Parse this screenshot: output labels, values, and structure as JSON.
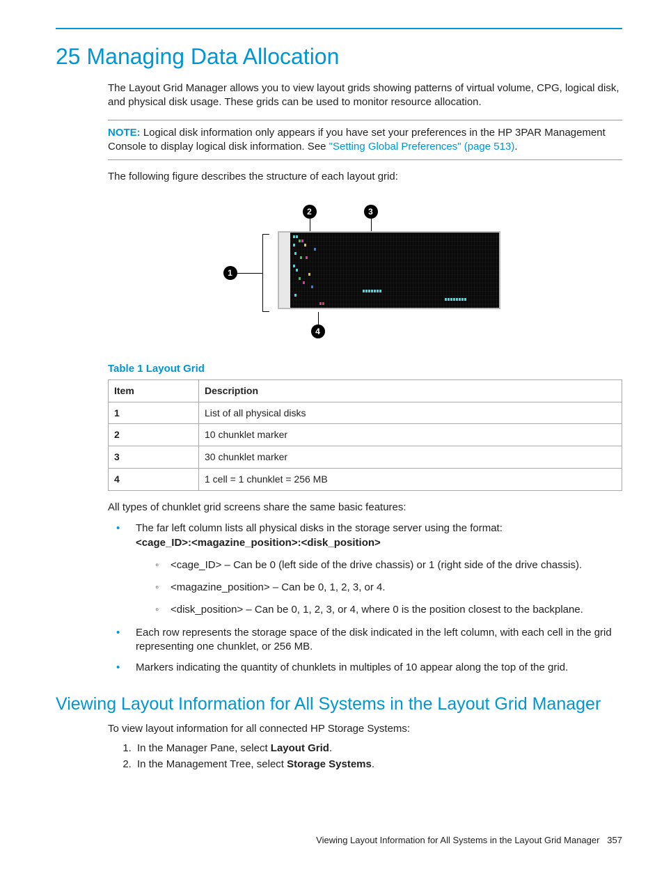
{
  "chapter": {
    "number": "25",
    "title": "Managing Data Allocation",
    "intro": "The Layout Grid Manager allows you to view layout grids showing patterns of virtual volume, CPG, logical disk, and physical disk usage. These grids can be used to monitor resource allocation."
  },
  "note": {
    "label": "NOTE:",
    "text": "Logical disk information only appears if you have set your preferences in the HP 3PAR Management Console to display logical disk information. See ",
    "link": "\"Setting Global Preferences\" (page 513)",
    "suffix": "."
  },
  "figure_intro": "The following figure describes the structure of each layout grid:",
  "callouts": {
    "c1": "1",
    "c2": "2",
    "c3": "3",
    "c4": "4"
  },
  "table": {
    "caption": "Table 1 Layout Grid",
    "headers": {
      "item": "Item",
      "desc": "Description"
    },
    "rows": [
      {
        "item": "1",
        "desc": "List of all physical disks"
      },
      {
        "item": "2",
        "desc": "10 chunklet marker"
      },
      {
        "item": "3",
        "desc": "30 chunklet marker"
      },
      {
        "item": "4",
        "desc": "1 cell = 1 chunklet = 256 MB"
      }
    ]
  },
  "after_table": "All types of chunklet grid screens share the same basic features:",
  "bullets": {
    "b1": "The far left column lists all physical disks in the storage server using the format: ",
    "b1_bold": "<cage_ID>:<magazine_position>:<disk_position>",
    "sub1": "<cage_ID> – Can be 0 (left side of the drive chassis) or 1 (right side of the drive chassis).",
    "sub2": "<magazine_position> – Can be 0, 1, 2, 3, or 4.",
    "sub3": "<disk_position> – Can be 0, 1, 2, 3, or 4, where 0 is the position closest to the backplane.",
    "b2": "Each row represents the storage space of the disk indicated in the left column, with each cell in the grid representing one chunklet, or 256 MB.",
    "b3": "Markers indicating the quantity of chunklets in multiples of 10 appear along the top of the grid."
  },
  "section2": {
    "heading": "Viewing Layout Information for All Systems in the Layout Grid Manager",
    "intro": "To view layout information for all connected HP Storage Systems:",
    "step1a": "In the Manager Pane, select ",
    "step1b": "Layout Grid",
    "step1c": ".",
    "step2a": "In the Management Tree, select ",
    "step2b": "Storage Systems",
    "step2c": "."
  },
  "footer": {
    "text": "Viewing Layout Information for All Systems in the Layout Grid Manager",
    "page": "357"
  }
}
